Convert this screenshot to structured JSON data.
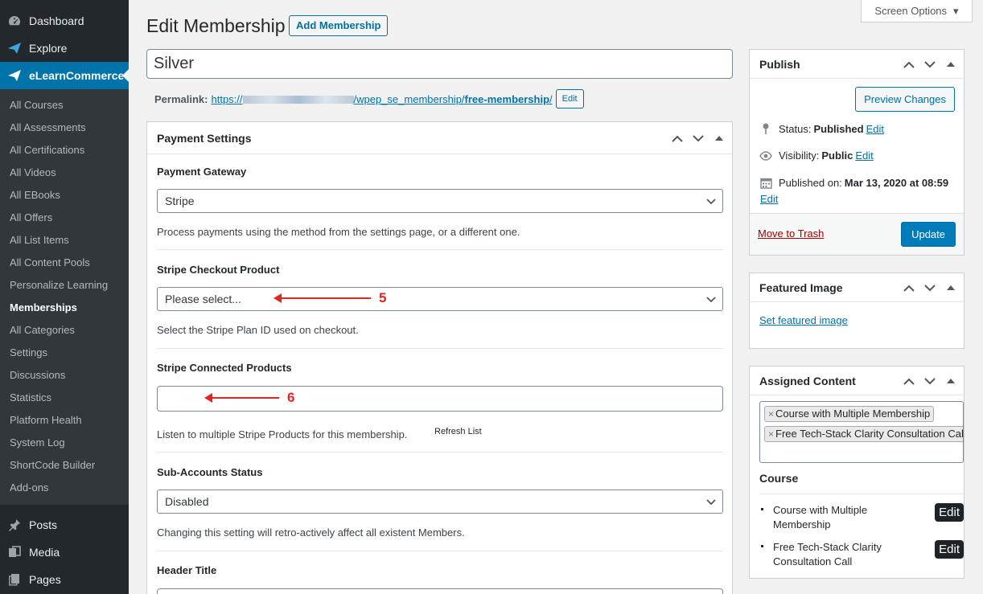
{
  "sidebar": {
    "top_items": [
      {
        "label": "Dashboard",
        "icon": "dashboard-icon"
      },
      {
        "label": "Explore",
        "icon": "explore-icon"
      },
      {
        "label": "eLearnCommerce",
        "icon": "elearncommerce-icon"
      }
    ],
    "submenu": [
      "All Courses",
      "All Assessments",
      "All Certifications",
      "All Videos",
      "All EBooks",
      "All Offers",
      "All List Items",
      "All Content Pools",
      "Personalize Learning",
      "Memberships",
      "All Categories",
      "Settings",
      "Discussions",
      "Statistics",
      "Platform Health",
      "System Log",
      "ShortCode Builder",
      "Add-ons"
    ],
    "bottom_items": [
      {
        "label": "Posts",
        "icon": "pin-icon"
      },
      {
        "label": "Media",
        "icon": "media-icon"
      },
      {
        "label": "Pages",
        "icon": "pages-icon"
      }
    ]
  },
  "header": {
    "screen_options": "Screen Options",
    "page_title": "Edit Membership",
    "add_button": "Add Membership"
  },
  "post": {
    "title": "Silver",
    "permalink_label": "Permalink:",
    "permalink_prefix": "https://",
    "permalink_mid": "/wpep_se_membership/",
    "permalink_slug": "free-membership",
    "permalink_end": "/",
    "permalink_edit": "Edit"
  },
  "payment": {
    "title": "Payment Settings",
    "gateway_label": "Payment Gateway",
    "gateway_value": "Stripe",
    "gateway_desc": "Process payments using the method from the settings page, or a different one.",
    "checkout_label": "Stripe Checkout Product",
    "checkout_value": "Please select...",
    "checkout_desc": "Select the Stripe Plan ID used on checkout.",
    "connected_label": "Stripe Connected Products",
    "connected_desc": "Listen to multiple Stripe Products for this membership.",
    "refresh": "Refresh List",
    "sub_label": "Sub-Accounts Status",
    "sub_value": "Disabled",
    "sub_desc": "Changing this setting will retro-actively affect all existent Members.",
    "header_label": "Header Title",
    "annot_5": "5",
    "annot_6": "6"
  },
  "publish": {
    "title": "Publish",
    "preview": "Preview Changes",
    "status_label": "Status:",
    "status_value": "Published",
    "visibility_label": "Visibility:",
    "visibility_value": "Public",
    "published_label": "Published on:",
    "published_value": "Mar 13, 2020 at 08:59",
    "edit": "Edit",
    "trash": "Move to Trash",
    "update": "Update"
  },
  "featured": {
    "title": "Featured Image",
    "link": "Set featured image"
  },
  "assigned": {
    "title": "Assigned Content",
    "tags": [
      "Course with Multiple Membership",
      "Free Tech-Stack Clarity Consultation Call"
    ],
    "course_heading": "Course",
    "courses": [
      "Course with Multiple Membership",
      "Free Tech-Stack Clarity Consultation Call"
    ],
    "edit": "Edit"
  },
  "colors": {
    "sidebar": "#23282d",
    "submenu": "#32373c",
    "accent": "#0073aa",
    "annotation": "#e2261f",
    "update": "#007cba"
  }
}
